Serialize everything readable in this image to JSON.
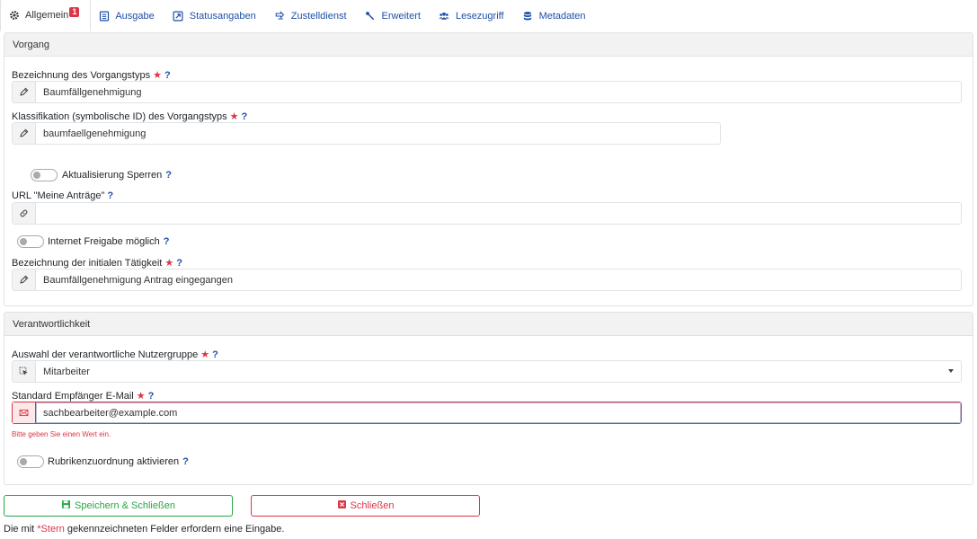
{
  "tabs": [
    {
      "label": "Allgemein",
      "icon": "gear-icon",
      "badge": "1"
    },
    {
      "label": "Ausgabe",
      "icon": "list-icon"
    },
    {
      "label": "Statusangaben",
      "icon": "status-icon"
    },
    {
      "label": "Zustelldienst",
      "icon": "delivery-icon"
    },
    {
      "label": "Erweitert",
      "icon": "wrench-icon"
    },
    {
      "label": "Lesezugriff",
      "icon": "users-icon"
    },
    {
      "label": "Metadaten",
      "icon": "database-icon"
    }
  ],
  "vorgang": {
    "header": "Vorgang",
    "typ_label": "Bezeichnung des Vorgangstyps",
    "typ_value": "Baumfällgenehmigung",
    "klass_label": "Klassifikation (symbolische ID) des Vorgangstyps",
    "klass_value": "baumfaellgenehmigung",
    "sperren_label": "Aktualisierung Sperren",
    "url_label": "URL \"Meine Anträge\"",
    "url_value": "",
    "internet_label": "Internet Freigabe möglich",
    "taetigkeit_label": "Bezeichnung der initialen Tätigkeit",
    "taetigkeit_value": "Baumfällgenehmigung Antrag eingegangen"
  },
  "verantwortlichkeit": {
    "header": "Verantwortlichkeit",
    "gruppe_label": "Auswahl der verantwortliche Nutzergruppe",
    "gruppe_value": "Mitarbeiter",
    "email_label": "Standard Empfänger E-Mail",
    "email_value": "sachbearbeiter@example.com",
    "email_error": "Bitte geben Sie einen Wert ein.",
    "rubrik_label": "Rubrikenzuordnung aktivieren"
  },
  "common": {
    "star": "★",
    "help": "?"
  },
  "buttons": {
    "save": "Speichern & Schließen",
    "close": "Schließen"
  },
  "footnote": {
    "prefix": "Die mit ",
    "star": "*Stern",
    "suffix": " gekennzeichneten Felder erfordern eine Eingabe."
  },
  "colors": {
    "accent": "#1f4fa8",
    "danger": "#dc3545",
    "success": "#28a745"
  }
}
